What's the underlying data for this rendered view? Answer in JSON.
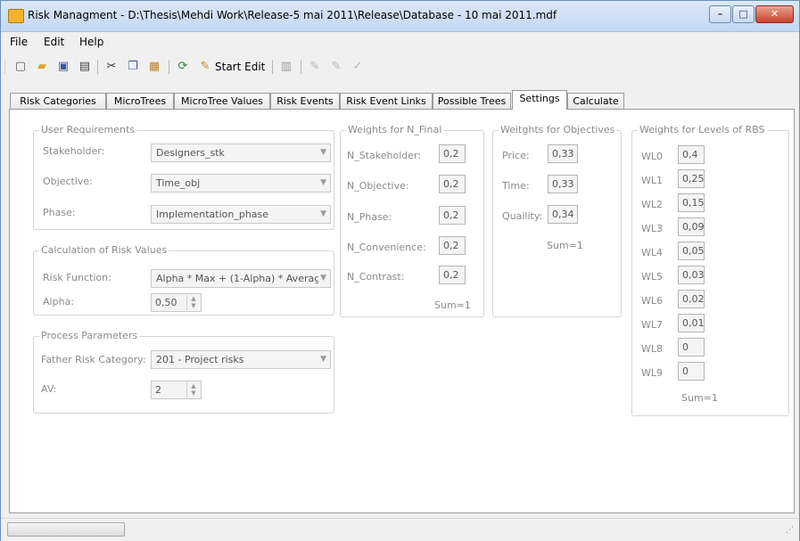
{
  "window": {
    "title": "Risk Managment - D:\\Thesis\\Mehdi Work\\Release-5 mai 2011\\Release\\Database - 10 mai 2011.mdf",
    "controls": [
      "–",
      "□",
      "✕"
    ]
  },
  "menu": [
    "File",
    "Edit",
    "Help"
  ],
  "toolbar": {
    "start_edit": "Start Edit"
  },
  "tabs": [
    {
      "label": "Risk Categories",
      "active": false
    },
    {
      "label": "MicroTrees",
      "active": false
    },
    {
      "label": "MicroTree Values",
      "active": false
    },
    {
      "label": "Risk Events",
      "active": false
    },
    {
      "label": "Risk Event Links",
      "active": false
    },
    {
      "label": "Possible Trees",
      "active": false
    },
    {
      "label": "Settings",
      "active": true
    },
    {
      "label": "Calculate",
      "active": false
    }
  ],
  "user_requirements": {
    "title": "User Requirements",
    "stakeholder_label": "Stakeholder:",
    "stakeholder_value": "Designers_stk",
    "objective_label": "Objective:",
    "objective_value": "Time_obj",
    "phase_label": "Phase:",
    "phase_value": "Implementation_phase"
  },
  "risk_values": {
    "title": "Calculation of Risk Values",
    "function_label": "Risk Function:",
    "function_value": "Alpha * Max + (1-Alpha) * Averag",
    "alpha_label": "Alpha:",
    "alpha_value": "0,50"
  },
  "process_params": {
    "title": "Process Parameters",
    "father_label": "Father Risk Category:",
    "father_value": "201 - Project risks",
    "av_label": "AV:",
    "av_value": "2"
  },
  "weights_n_final": {
    "title": "Weights for N_Final",
    "items": [
      {
        "label": "N_Stakeholder:",
        "value": "0,2"
      },
      {
        "label": "N_Objective:",
        "value": "0,2"
      },
      {
        "label": "N_Phase:",
        "value": "0,2"
      },
      {
        "label": "N_Convenience:",
        "value": "0,2"
      },
      {
        "label": "N_Contrast:",
        "value": "0,2"
      }
    ],
    "sum": "Sum=1"
  },
  "weights_objectives": {
    "title": "Weitghts for Objectives",
    "items": [
      {
        "label": "Price:",
        "value": "0,33"
      },
      {
        "label": "Time:",
        "value": "0,33"
      },
      {
        "label": "Quaility:",
        "value": "0,34"
      }
    ],
    "sum": "Sum=1"
  },
  "weights_rbs": {
    "title": "Weights for Levels of RBS",
    "items": [
      {
        "label": "WL0",
        "value": "0,4"
      },
      {
        "label": "WL1",
        "value": "0,25"
      },
      {
        "label": "WL2",
        "value": "0,15"
      },
      {
        "label": "WL3",
        "value": "0,09"
      },
      {
        "label": "WL4",
        "value": "0,05"
      },
      {
        "label": "WL5",
        "value": "0,03"
      },
      {
        "label": "WL6",
        "value": "0,02"
      },
      {
        "label": "WL7",
        "value": "0,01"
      },
      {
        "label": "WL8",
        "value": "0"
      },
      {
        "label": "WL9",
        "value": "0"
      }
    ],
    "sum": "Sum=1"
  }
}
